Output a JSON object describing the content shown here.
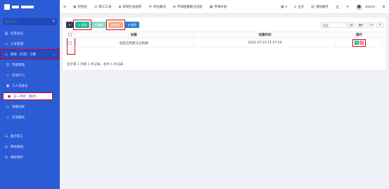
{
  "sidebar": {
    "search": {
      "placeholder": "搜索菜单"
    },
    "items": [
      {
        "label": "信息总览",
        "icon": "file-icon"
      },
      {
        "label": "工会管理",
        "icon": "folder-icon"
      },
      {
        "label": "教育（示范）引擎",
        "icon": "circle-icon"
      },
      {
        "label": "劳模管理",
        "icon": "user-icon"
      },
      {
        "label": "在线学习",
        "icon": "diamond-icon"
      },
      {
        "label": "工人先锋号",
        "icon": "flag-icon"
      },
      {
        "label": "五一奖状（集体）",
        "icon": "circle-icon"
      },
      {
        "label": "劳模创新",
        "icon": "circle-icon"
      },
      {
        "label": "交流模块",
        "icon": "diamond-icon"
      },
      {
        "label": "医疗职工",
        "icon": "users-icon"
      },
      {
        "label": "帮扶救助",
        "icon": "circle-icon"
      },
      {
        "label": "维权保护",
        "icon": "circle-icon"
      }
    ]
  },
  "topbar": {
    "items": [
      {
        "label": "控制台",
        "icon": "dashboard-icon"
      },
      {
        "label": "职工工会",
        "icon": "users-icon"
      },
      {
        "label": "新增社会组织",
        "icon": "org-icon"
      },
      {
        "label": "单位概况",
        "icon": "gear-icon"
      },
      {
        "label": "申请困难职业流程",
        "icon": "flow-icon"
      },
      {
        "label": "申请补贴",
        "icon": "doc-icon"
      }
    ],
    "right": {
      "home": "主页",
      "clear": "清除缓存",
      "user": "Admin"
    }
  },
  "toolbar": {
    "add": "添加",
    "edit": "编辑",
    "delete": "删除",
    "more": "更多",
    "search_placeholder": "搜索"
  },
  "table": {
    "headers": [
      "标题",
      "创建时间",
      "操作"
    ],
    "rows": [
      {
        "title": "恒昌吉凯建马立机械",
        "created": "2022-07-19 11:07:50"
      }
    ],
    "footer": "显示第 1 到第 1 条记录，总共 1 条记录"
  },
  "colors": {
    "sidebar": "#2c5bd6",
    "highlight": "#d8001d",
    "add": "#1abc9c",
    "delete": "#f4a98f"
  }
}
